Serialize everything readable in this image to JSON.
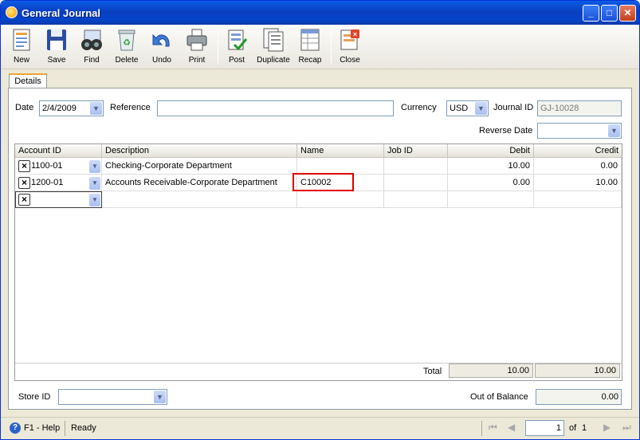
{
  "window": {
    "title": "General Journal",
    "minimize": "_",
    "maximize": "□",
    "close": "✕"
  },
  "toolbar": {
    "new": "New",
    "save": "Save",
    "find": "Find",
    "delete": "Delete",
    "undo": "Undo",
    "print": "Print",
    "post": "Post",
    "duplicate": "Duplicate",
    "recap": "Recap",
    "close": "Close"
  },
  "tabs": {
    "details": "Details"
  },
  "form": {
    "date_label": "Date",
    "date_value": "2/4/2009",
    "reference_label": "Reference",
    "reference_value": "",
    "currency_label": "Currency",
    "currency_value": "USD",
    "journal_id_label": "Journal ID",
    "journal_id_value": "GJ-10028",
    "reverse_date_label": "Reverse Date",
    "reverse_date_value": ""
  },
  "grid": {
    "columns": [
      "Account ID",
      "Description",
      "Name",
      "Job ID",
      "Debit",
      "Credit"
    ],
    "rows": [
      {
        "account_id": "1100-01",
        "description": "Checking-Corporate Department",
        "name": "",
        "job_id": "",
        "debit": "10.00",
        "credit": "0.00"
      },
      {
        "account_id": "1200-01",
        "description": "Accounts Receivable-Corporate Department",
        "name": "C10002",
        "job_id": "",
        "debit": "0.00",
        "credit": "10.00"
      }
    ],
    "total_label": "Total",
    "total_debit": "10.00",
    "total_credit": "10.00"
  },
  "footer": {
    "store_id_label": "Store ID",
    "store_id_value": "",
    "out_of_balance_label": "Out of Balance",
    "out_of_balance_value": "0.00"
  },
  "statusbar": {
    "help": "F1 - Help",
    "status": "Ready",
    "page": "1",
    "of_label": "of",
    "total_pages": "1"
  }
}
